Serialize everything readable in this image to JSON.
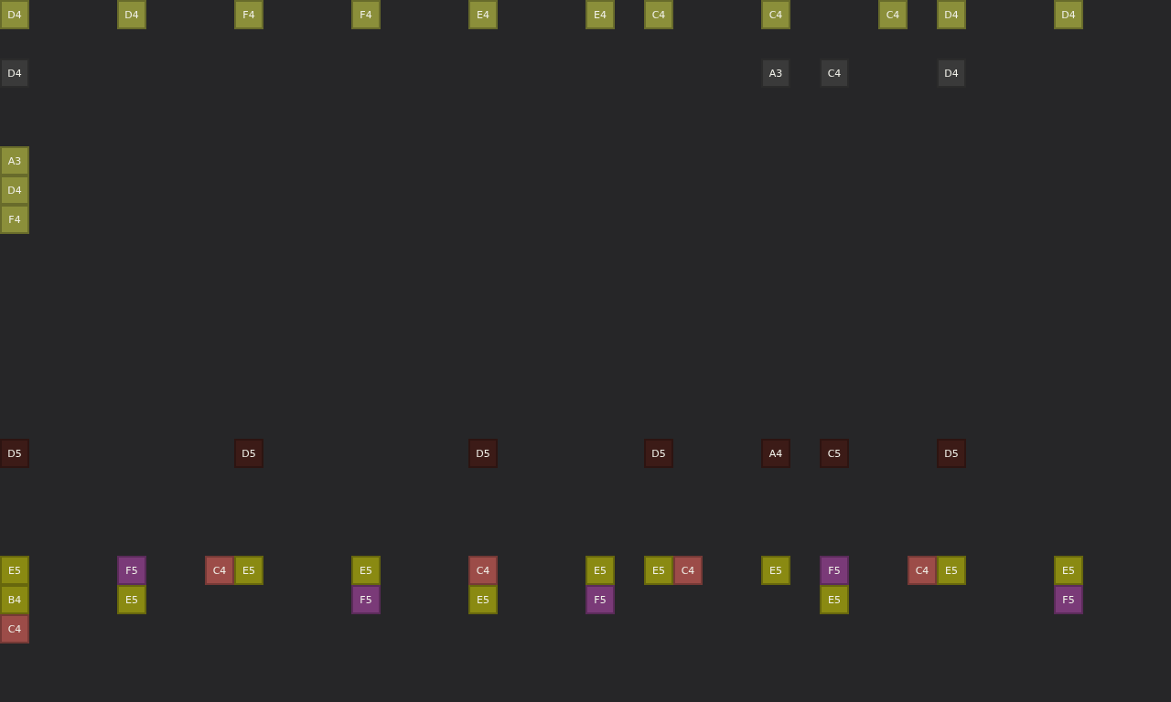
{
  "lanes": [
    {
      "kind": "notes",
      "steps": [
        {
          "kind": "note",
          "label": "D4",
          "color": "#8b8f3a"
        },
        {
          "kind": "rest"
        },
        {
          "kind": "rest"
        },
        {
          "kind": "rest"
        },
        {
          "kind": "note",
          "label": "D4",
          "color": "#8b8f3a"
        },
        {
          "kind": "rest"
        },
        {
          "kind": "rest"
        },
        {
          "kind": "rest"
        },
        {
          "kind": "note",
          "label": "F4",
          "color": "#8b8f3a"
        },
        {
          "kind": "rest"
        },
        {
          "kind": "rest"
        },
        {
          "kind": "rest"
        },
        {
          "kind": "note",
          "label": "F4",
          "color": "#8b8f3a"
        },
        {
          "kind": "rest"
        },
        {
          "kind": "rest"
        },
        {
          "kind": "rest"
        },
        {
          "kind": "note",
          "label": "E4",
          "color": "#8b8f3a"
        },
        {
          "kind": "rest"
        },
        {
          "kind": "rest"
        },
        {
          "kind": "rest"
        },
        {
          "kind": "note",
          "label": "E4",
          "color": "#8b8f3a"
        },
        {
          "kind": "rest"
        },
        {
          "kind": "note",
          "label": "C4",
          "color": "#8b8f3a"
        },
        {
          "kind": "rest"
        },
        {
          "kind": "rest"
        },
        {
          "kind": "rest"
        },
        {
          "kind": "note",
          "label": "C4",
          "color": "#8b8f3a"
        },
        {
          "kind": "rest"
        },
        {
          "kind": "rest"
        },
        {
          "kind": "rest"
        },
        {
          "kind": "note",
          "label": "C4",
          "color": "#8b8f3a"
        },
        {
          "kind": "rest"
        },
        {
          "kind": "note",
          "label": "D4",
          "color": "#8b8f3a"
        },
        {
          "kind": "rest"
        },
        {
          "kind": "rest"
        },
        {
          "kind": "rest"
        },
        {
          "kind": "note",
          "label": "D4",
          "color": "#8b8f3a"
        }
      ]
    },
    {
      "kind": "blank"
    },
    {
      "kind": "notes",
      "steps": [
        {
          "kind": "note",
          "label": "D4",
          "color": "#3a3a3a"
        },
        {
          "kind": "rest"
        },
        {
          "kind": "rest"
        },
        {
          "kind": "rest"
        },
        {
          "kind": "rest"
        },
        {
          "kind": "rest"
        },
        {
          "kind": "rest"
        },
        {
          "kind": "rest"
        },
        {
          "kind": "rest"
        },
        {
          "kind": "rest"
        },
        {
          "kind": "rest"
        },
        {
          "kind": "rest"
        },
        {
          "kind": "rest"
        },
        {
          "kind": "rest"
        },
        {
          "kind": "rest"
        },
        {
          "kind": "rest"
        },
        {
          "kind": "rest"
        },
        {
          "kind": "rest"
        },
        {
          "kind": "rest"
        },
        {
          "kind": "rest"
        },
        {
          "kind": "rest"
        },
        {
          "kind": "rest"
        },
        {
          "kind": "rest"
        },
        {
          "kind": "rest"
        },
        {
          "kind": "rest"
        },
        {
          "kind": "rest"
        },
        {
          "kind": "note",
          "label": "A3",
          "color": "#3a3a3a"
        },
        {
          "kind": "rest"
        },
        {
          "kind": "note",
          "label": "C4",
          "color": "#3a3a3a"
        },
        {
          "kind": "rest"
        },
        {
          "kind": "rest"
        },
        {
          "kind": "rest"
        },
        {
          "kind": "note",
          "label": "D4",
          "color": "#3a3a3a"
        }
      ]
    },
    {
      "kind": "blank"
    },
    {
      "kind": "blank"
    },
    {
      "kind": "notes",
      "steps": [
        {
          "kind": "note",
          "label": "A3",
          "color": "#8b8f3a"
        }
      ]
    },
    {
      "kind": "notes",
      "steps": [
        {
          "kind": "note",
          "label": "D4",
          "color": "#8b8f3a"
        }
      ]
    },
    {
      "kind": "notes",
      "steps": [
        {
          "kind": "note",
          "label": "F4",
          "color": "#8b8f3a"
        }
      ]
    },
    {
      "kind": "blank"
    },
    {
      "kind": "blank"
    },
    {
      "kind": "blank"
    },
    {
      "kind": "blank"
    },
    {
      "kind": "blank"
    },
    {
      "kind": "blank"
    },
    {
      "kind": "blank"
    },
    {
      "kind": "notes",
      "steps": [
        {
          "kind": "note",
          "label": "D5",
          "color": "#3c1b17"
        },
        {
          "kind": "rest"
        },
        {
          "kind": "rest"
        },
        {
          "kind": "rest"
        },
        {
          "kind": "rest"
        },
        {
          "kind": "rest"
        },
        {
          "kind": "rest"
        },
        {
          "kind": "rest"
        },
        {
          "kind": "note",
          "label": "D5",
          "color": "#3c1b17"
        },
        {
          "kind": "rest"
        },
        {
          "kind": "rest"
        },
        {
          "kind": "rest"
        },
        {
          "kind": "rest"
        },
        {
          "kind": "rest"
        },
        {
          "kind": "rest"
        },
        {
          "kind": "rest"
        },
        {
          "kind": "note",
          "label": "D5",
          "color": "#3c1b17"
        },
        {
          "kind": "rest"
        },
        {
          "kind": "rest"
        },
        {
          "kind": "rest"
        },
        {
          "kind": "rest"
        },
        {
          "kind": "rest"
        },
        {
          "kind": "note",
          "label": "D5",
          "color": "#3c1b17"
        },
        {
          "kind": "rest"
        },
        {
          "kind": "rest"
        },
        {
          "kind": "rest"
        },
        {
          "kind": "note",
          "label": "A4",
          "color": "#3c1b17"
        },
        {
          "kind": "rest"
        },
        {
          "kind": "note",
          "label": "C5",
          "color": "#3c1b17"
        },
        {
          "kind": "rest"
        },
        {
          "kind": "rest"
        },
        {
          "kind": "rest"
        },
        {
          "kind": "note",
          "label": "D5",
          "color": "#3c1b17"
        }
      ]
    },
    {
      "kind": "blank"
    },
    {
      "kind": "blank"
    },
    {
      "kind": "blank"
    },
    {
      "kind": "notes",
      "steps": [
        {
          "kind": "note",
          "label": "E5",
          "color": "#8a8a12"
        },
        {
          "kind": "rest"
        },
        {
          "kind": "rest"
        },
        {
          "kind": "rest"
        },
        {
          "kind": "note",
          "label": "F5",
          "color": "#7a3a78"
        },
        {
          "kind": "rest"
        },
        {
          "kind": "rest"
        },
        {
          "kind": "note",
          "label": "C4",
          "color": "#9c4c48"
        },
        {
          "kind": "note",
          "label": "E5",
          "color": "#8a8a12"
        },
        {
          "kind": "rest"
        },
        {
          "kind": "rest"
        },
        {
          "kind": "rest"
        },
        {
          "kind": "note",
          "label": "E5",
          "color": "#8a8a12"
        },
        {
          "kind": "rest"
        },
        {
          "kind": "rest"
        },
        {
          "kind": "rest"
        },
        {
          "kind": "note",
          "label": "C4",
          "color": "#9c4c48"
        },
        {
          "kind": "rest"
        },
        {
          "kind": "rest"
        },
        {
          "kind": "rest"
        },
        {
          "kind": "note",
          "label": "E5",
          "color": "#8a8a12"
        },
        {
          "kind": "rest"
        },
        {
          "kind": "note",
          "label": "E5",
          "color": "#8a8a12"
        },
        {
          "kind": "note",
          "label": "C4",
          "color": "#9c4c48"
        },
        {
          "kind": "rest"
        },
        {
          "kind": "rest"
        },
        {
          "kind": "note",
          "label": "E5",
          "color": "#8a8a12"
        },
        {
          "kind": "rest"
        },
        {
          "kind": "note",
          "label": "F5",
          "color": "#7a3a78"
        },
        {
          "kind": "rest"
        },
        {
          "kind": "rest"
        },
        {
          "kind": "note",
          "label": "C4",
          "color": "#9c4c48"
        },
        {
          "kind": "note",
          "label": "E5",
          "color": "#8a8a12"
        },
        {
          "kind": "rest"
        },
        {
          "kind": "rest"
        },
        {
          "kind": "rest"
        },
        {
          "kind": "note",
          "label": "E5",
          "color": "#8a8a12"
        }
      ]
    },
    {
      "kind": "notes",
      "steps": [
        {
          "kind": "note",
          "label": "B4",
          "color": "#8a8a12"
        },
        {
          "kind": "rest"
        },
        {
          "kind": "rest"
        },
        {
          "kind": "rest"
        },
        {
          "kind": "note",
          "label": "E5",
          "color": "#8a8a12"
        },
        {
          "kind": "rest"
        },
        {
          "kind": "rest"
        },
        {
          "kind": "rest"
        },
        {
          "kind": "rest"
        },
        {
          "kind": "rest"
        },
        {
          "kind": "rest"
        },
        {
          "kind": "rest"
        },
        {
          "kind": "note",
          "label": "F5",
          "color": "#7a3a78"
        },
        {
          "kind": "rest"
        },
        {
          "kind": "rest"
        },
        {
          "kind": "rest"
        },
        {
          "kind": "note",
          "label": "E5",
          "color": "#8a8a12"
        },
        {
          "kind": "rest"
        },
        {
          "kind": "rest"
        },
        {
          "kind": "rest"
        },
        {
          "kind": "note",
          "label": "F5",
          "color": "#7a3a78"
        },
        {
          "kind": "rest"
        },
        {
          "kind": "rest"
        },
        {
          "kind": "rest"
        },
        {
          "kind": "rest"
        },
        {
          "kind": "rest"
        },
        {
          "kind": "rest"
        },
        {
          "kind": "rest"
        },
        {
          "kind": "note",
          "label": "E5",
          "color": "#8a8a12"
        },
        {
          "kind": "rest"
        },
        {
          "kind": "rest"
        },
        {
          "kind": "rest"
        },
        {
          "kind": "rest"
        },
        {
          "kind": "rest"
        },
        {
          "kind": "rest"
        },
        {
          "kind": "rest"
        },
        {
          "kind": "note",
          "label": "F5",
          "color": "#7a3a78"
        }
      ]
    },
    {
      "kind": "notes",
      "steps": [
        {
          "kind": "note",
          "label": "C4",
          "color": "#9c4c48"
        }
      ]
    }
  ]
}
